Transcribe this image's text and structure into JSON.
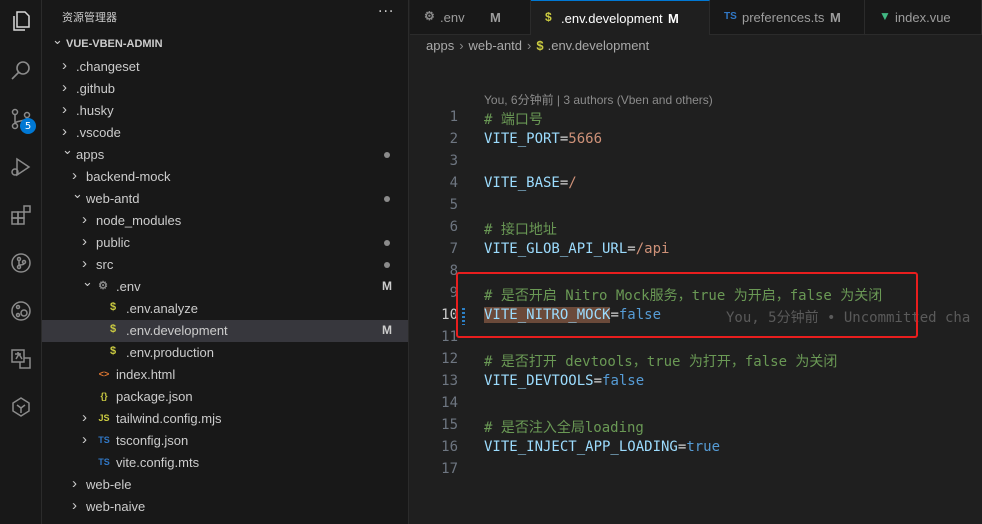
{
  "sidebar": {
    "title": "资源管理器",
    "more": "···",
    "tree": [
      {
        "label": "VUE-VBEN-ADMIN",
        "depth": 0,
        "chev": "open",
        "icon": "",
        "status": "",
        "root": true
      },
      {
        "label": ".changeset",
        "depth": 1,
        "chev": "closed",
        "icon": "",
        "status": ""
      },
      {
        "label": ".github",
        "depth": 1,
        "chev": "closed",
        "icon": "",
        "status": ""
      },
      {
        "label": ".husky",
        "depth": 1,
        "chev": "closed",
        "icon": "",
        "status": ""
      },
      {
        "label": ".vscode",
        "depth": 1,
        "chev": "closed",
        "icon": "",
        "status": ""
      },
      {
        "label": "apps",
        "depth": 1,
        "chev": "open",
        "icon": "",
        "status": "dot"
      },
      {
        "label": "backend-mock",
        "depth": 2,
        "chev": "closed",
        "icon": "",
        "status": ""
      },
      {
        "label": "web-antd",
        "depth": 2,
        "chev": "open",
        "icon": "",
        "status": "dot"
      },
      {
        "label": "node_modules",
        "depth": 3,
        "chev": "closed",
        "icon": "",
        "status": ""
      },
      {
        "label": "public",
        "depth": 3,
        "chev": "closed",
        "icon": "",
        "status": "dot"
      },
      {
        "label": "src",
        "depth": 3,
        "chev": "closed",
        "icon": "",
        "status": "dot"
      },
      {
        "label": ".env",
        "depth": 3,
        "chev": "open",
        "icon": "gear",
        "status": "M"
      },
      {
        "label": ".env.analyze",
        "depth": 4,
        "chev": "",
        "icon": "dollar",
        "status": ""
      },
      {
        "label": ".env.development",
        "depth": 4,
        "chev": "",
        "icon": "dollar",
        "status": "M",
        "selected": true
      },
      {
        "label": ".env.production",
        "depth": 4,
        "chev": "",
        "icon": "dollar",
        "status": ""
      },
      {
        "label": "index.html",
        "depth": 3,
        "chev": "",
        "icon": "html",
        "status": ""
      },
      {
        "label": "package.json",
        "depth": 3,
        "chev": "",
        "icon": "json",
        "status": ""
      },
      {
        "label": "tailwind.config.mjs",
        "depth": 3,
        "chev": "closed",
        "icon": "js",
        "status": ""
      },
      {
        "label": "tsconfig.json",
        "depth": 3,
        "chev": "closed",
        "icon": "tsjson",
        "status": ""
      },
      {
        "label": "vite.config.mts",
        "depth": 3,
        "chev": "",
        "icon": "ts",
        "status": ""
      },
      {
        "label": "web-ele",
        "depth": 2,
        "chev": "closed",
        "icon": "",
        "status": ""
      },
      {
        "label": "web-naive",
        "depth": 2,
        "chev": "closed",
        "icon": "",
        "status": ""
      }
    ]
  },
  "activity": {
    "source_control_badge": "5",
    "icons": [
      "explorer-icon",
      "search-icon",
      "source-control-icon",
      "run-debug-icon",
      "extensions-icon",
      "git-graph-icon",
      "gitlens-icon",
      "translate-icon",
      "remote-icon"
    ]
  },
  "tabs": [
    {
      "label": ".env",
      "flag": "M",
      "icon": "gear",
      "active": false
    },
    {
      "label": ".env.development",
      "flag": "M",
      "icon": "dollar",
      "active": true
    },
    {
      "label": "preferences.ts",
      "flag": "M",
      "icon": "ts",
      "active": false
    },
    {
      "label": "index.vue",
      "flag": "",
      "icon": "vue",
      "active": false
    }
  ],
  "breadcrumb": {
    "parts": [
      "apps",
      "web-antd",
      ".env.development"
    ]
  },
  "editor": {
    "blame_top": "You, 6分钟前 | 3 authors (Vben and others)",
    "current_line": 10,
    "ghost_blame": "You, 5分钟前 • Uncommitted cha",
    "lines": [
      {
        "n": "1",
        "type": "comment",
        "text": "# 端口号"
      },
      {
        "n": "2",
        "type": "kv",
        "key": "VITE_PORT",
        "value": "5666",
        "vclass": "v"
      },
      {
        "n": "3",
        "type": "empty"
      },
      {
        "n": "4",
        "type": "kv",
        "key": "VITE_BASE",
        "value": "/",
        "vclass": "v"
      },
      {
        "n": "5",
        "type": "empty"
      },
      {
        "n": "6",
        "type": "comment",
        "text": "# 接口地址"
      },
      {
        "n": "7",
        "type": "kv",
        "key": "VITE_GLOB_API_URL",
        "value": "/api",
        "vclass": "v"
      },
      {
        "n": "8",
        "type": "empty"
      },
      {
        "n": "9",
        "type": "comment",
        "text": "# 是否开启 Nitro Mock服务，true 为开启，false 为关闭"
      },
      {
        "n": "10",
        "type": "kv",
        "key": "VITE_NITRO_MOCK",
        "value": "false",
        "vclass": "b",
        "selected": true
      },
      {
        "n": "11",
        "type": "empty"
      },
      {
        "n": "12",
        "type": "comment",
        "text": "# 是否打开 devtools，true 为打开，false 为关闭"
      },
      {
        "n": "13",
        "type": "kv",
        "key": "VITE_DEVTOOLS",
        "value": "false",
        "vclass": "b"
      },
      {
        "n": "14",
        "type": "empty"
      },
      {
        "n": "15",
        "type": "comment",
        "text": "# 是否注入全局loading"
      },
      {
        "n": "16",
        "type": "kv",
        "key": "VITE_INJECT_APP_LOADING",
        "value": "true",
        "vclass": "b"
      },
      {
        "n": "17",
        "type": "empty"
      }
    ]
  },
  "colors": {
    "accent": "#0078d4",
    "highlight_box": "#e81e1e",
    "dollar_icon": "#cbcb41",
    "ts_icon": "#3178c6",
    "vue_icon": "#41b883",
    "json_icon": "#cbcb41",
    "html_icon": "#e37933"
  }
}
